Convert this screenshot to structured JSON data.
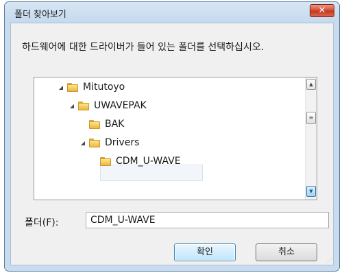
{
  "window": {
    "title": "폴더 찾아보기",
    "close_label": "✕"
  },
  "dialog": {
    "description": "하드웨어에 대한 드라이버가 들어 있는 폴더를 선택하십시오."
  },
  "tree": {
    "items": [
      {
        "label": "Mitutoyo",
        "expander": "◢"
      },
      {
        "label": "UWAVEPAK",
        "expander": "◢"
      },
      {
        "label": "BAK",
        "expander": ""
      },
      {
        "label": "Drivers",
        "expander": "◢"
      },
      {
        "label": "CDM_U-WAVE",
        "expander": "",
        "selected": true
      }
    ],
    "scroll_up": "▲",
    "scroll_grip": "≡",
    "scroll_down": "▼"
  },
  "folder_field": {
    "label": "폴더(F):",
    "value": "CDM_U-WAVE"
  },
  "buttons": {
    "ok": "확인",
    "cancel": "취소"
  },
  "colors": {
    "title_bar": "#c9dcef",
    "close_button": "#d24b31",
    "selection": "#f2f6fb",
    "folder_icon": "#eab83f"
  },
  "icons": [
    "folder-icon",
    "close-icon",
    "expand-arrow-icon",
    "scroll-up-icon",
    "scroll-down-icon",
    "resize-grip-icon"
  ]
}
